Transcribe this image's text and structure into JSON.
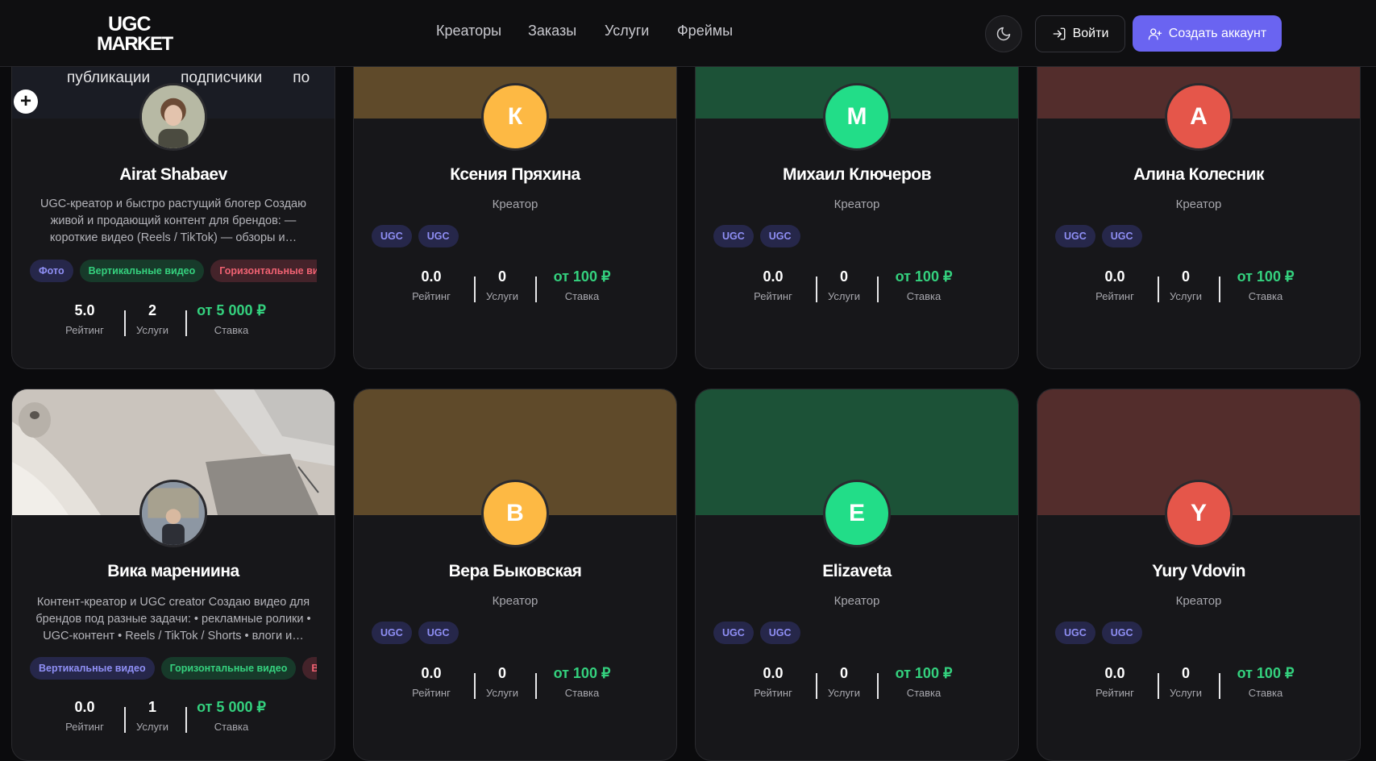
{
  "header": {
    "logo_top": "UGC",
    "logo_bottom": "MARKET",
    "nav": [
      "Креаторы",
      "Заказы",
      "Услуги",
      "Фреймы"
    ],
    "login_label": "Войти",
    "signup_label": "Создать аккаунт",
    "accent_color": "#6a64f1"
  },
  "story_bar": [
    "публикации",
    "подписчики",
    "по"
  ],
  "stat_labels": {
    "rating": "Рейтинг",
    "services": "Услуги",
    "rate": "Ставка"
  },
  "cards": [
    {
      "name": "Airat Shabaev",
      "bio": "UGC-креатор и быстро растущий блогер Создаю живой и продающий контент для брендов: — короткие видео (Reels / TikTok) — обзоры и…",
      "tags": [
        "Фото",
        "Вертикальные видео",
        "Горизонтальные видео"
      ],
      "rating": "5.0",
      "services": "2",
      "rate": "от 5 000 ₽"
    },
    {
      "name": "Ксения Пряхина",
      "initial": "К",
      "role": "Креатор",
      "tags": [
        "UGC",
        "UGC"
      ],
      "rating": "0.0",
      "services": "0",
      "rate": "от 100 ₽",
      "cover_color": "#5f4a2a",
      "avatar_color": "#fdb944"
    },
    {
      "name": "Михаил Ключеров",
      "initial": "М",
      "role": "Креатор",
      "tags": [
        "UGC",
        "UGC"
      ],
      "rating": "0.0",
      "services": "0",
      "rate": "от 100 ₽",
      "cover_color": "#1c5237",
      "avatar_color": "#22dd88"
    },
    {
      "name": "Алина Колесник",
      "initial": "А",
      "role": "Креатор",
      "tags": [
        "UGC",
        "UGC"
      ],
      "rating": "0.0",
      "services": "0",
      "rate": "от 100 ₽",
      "cover_color": "#532d2c",
      "avatar_color": "#e5564a"
    },
    {
      "name": "Вика марениина",
      "bio": "Контент-креатор и UGC creator Создаю видео для брендов под разные задачи: • рекламные ролики • UGC-контент • Reels / TikTok / Shorts • влоги и…",
      "tags": [
        "Вертикальные видео",
        "Горизонтальные видео",
        "Вид"
      ],
      "rating": "0.0",
      "services": "1",
      "rate": "от 5 000 ₽"
    },
    {
      "name": "Вера Быковская",
      "initial": "В",
      "role": "Креатор",
      "tags": [
        "UGC",
        "UGC"
      ],
      "rating": "0.0",
      "services": "0",
      "rate": "от 100 ₽",
      "cover_color": "#5f4a2a",
      "avatar_color": "#fdb944"
    },
    {
      "name": "Elizaveta",
      "initial": "E",
      "role": "Креатор",
      "tags": [
        "UGC",
        "UGC"
      ],
      "rating": "0.0",
      "services": "0",
      "rate": "от 100 ₽",
      "cover_color": "#1c5237",
      "avatar_color": "#22dd88"
    },
    {
      "name": "Yury Vdovin",
      "initial": "Y",
      "role": "Креатор",
      "tags": [
        "UGC",
        "UGC"
      ],
      "rating": "0.0",
      "services": "0",
      "rate": "от 100 ₽",
      "cover_color": "#532d2c",
      "avatar_color": "#e5564a"
    }
  ]
}
